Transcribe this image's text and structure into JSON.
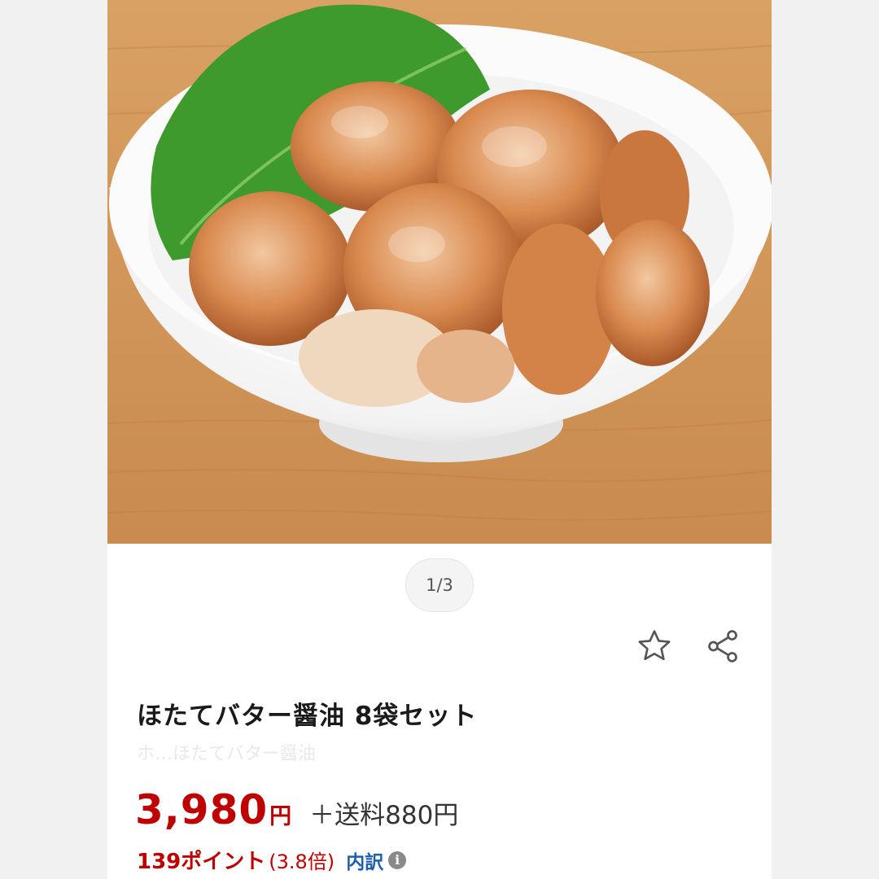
{
  "gallery": {
    "page_indicator": "1/3"
  },
  "actions": {
    "favorite_icon": "star-outline-icon",
    "share_icon": "share-icon"
  },
  "product": {
    "title": "ほたてバター醤油 8袋セット",
    "subtitle": "ホ…ほたてバター醤油"
  },
  "pricing": {
    "price": "3,980",
    "currency": "円",
    "shipping": "＋送料880円",
    "points": "139ポイント",
    "multiplier": "(3.8倍)",
    "breakdown_label": "内訳",
    "info_icon_glyph": "i"
  },
  "colors": {
    "price_red": "#bf0000",
    "link_blue": "#1d5fa8"
  }
}
